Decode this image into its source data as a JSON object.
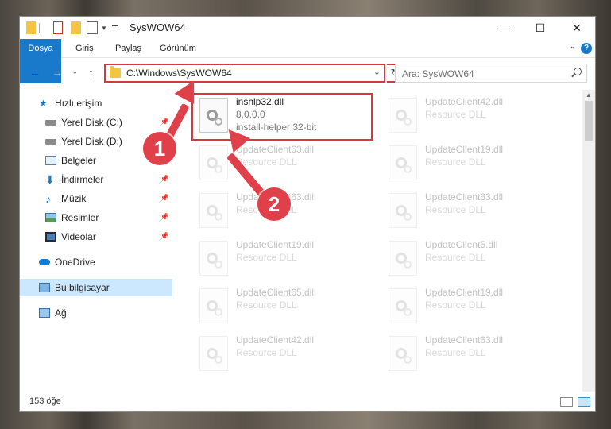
{
  "window": {
    "title": "SysWOW64",
    "minimize_glyph": "—",
    "maximize_glyph": "☐",
    "close_glyph": "✕"
  },
  "ribbon": {
    "tabs": [
      "Dosya",
      "Giriş",
      "Paylaş",
      "Görünüm"
    ]
  },
  "address": {
    "path": "C:\\Windows\\SysWOW64",
    "search_placeholder": "Ara: SysWOW64"
  },
  "nav": {
    "quick_access": "Hızlı erişim",
    "items": [
      {
        "label": "Yerel Disk (C:)",
        "icon": "drive-icon",
        "pinned": true
      },
      {
        "label": "Yerel Disk (D:)",
        "icon": "drive-icon",
        "pinned": true
      },
      {
        "label": "Belgeler",
        "icon": "documents-icon",
        "pinned": true
      },
      {
        "label": "İndirmeler",
        "icon": "download-icon",
        "pinned": true
      },
      {
        "label": "Müzik",
        "icon": "music-icon",
        "pinned": true
      },
      {
        "label": "Resimler",
        "icon": "pictures-icon",
        "pinned": true
      },
      {
        "label": "Videolar",
        "icon": "videos-icon",
        "pinned": true
      }
    ],
    "onedrive": "OneDrive",
    "this_pc": "Bu bilgisayar",
    "network": "Ağ"
  },
  "files": {
    "selected": {
      "name": "inshlp32.dll",
      "version": "8.0.0.0",
      "description": "install-helper 32-bit"
    },
    "left_column": [
      {
        "name": "UpdateClient63.dll",
        "type": "Resource DLL"
      },
      {
        "name": "UpdateClient63.dll",
        "type": "Resource DLL"
      },
      {
        "name": "UpdateClient19.dll",
        "type": "Resource DLL"
      },
      {
        "name": "UpdateClient65.dll",
        "type": "Resource DLL"
      },
      {
        "name": "UpdateClient42.dll",
        "type": "Resource DLL"
      }
    ],
    "right_column": [
      {
        "name": "UpdateClient42.dll",
        "type": "Resource DLL"
      },
      {
        "name": "UpdateClient19.dll",
        "type": "Resource DLL"
      },
      {
        "name": "UpdateClient63.dll",
        "type": "Resource DLL"
      },
      {
        "name": "UpdateClient5.dll",
        "type": "Resource DLL"
      },
      {
        "name": "UpdateClient19.dll",
        "type": "Resource DLL"
      },
      {
        "name": "UpdateClient63.dll",
        "type": "Resource DLL"
      }
    ]
  },
  "status": {
    "item_count": "153 öğe"
  },
  "annotations": {
    "step1": "1",
    "step2": "2"
  },
  "colors": {
    "accent": "#1979ca",
    "highlight": "#d9363e",
    "selection": "#cce8ff"
  }
}
